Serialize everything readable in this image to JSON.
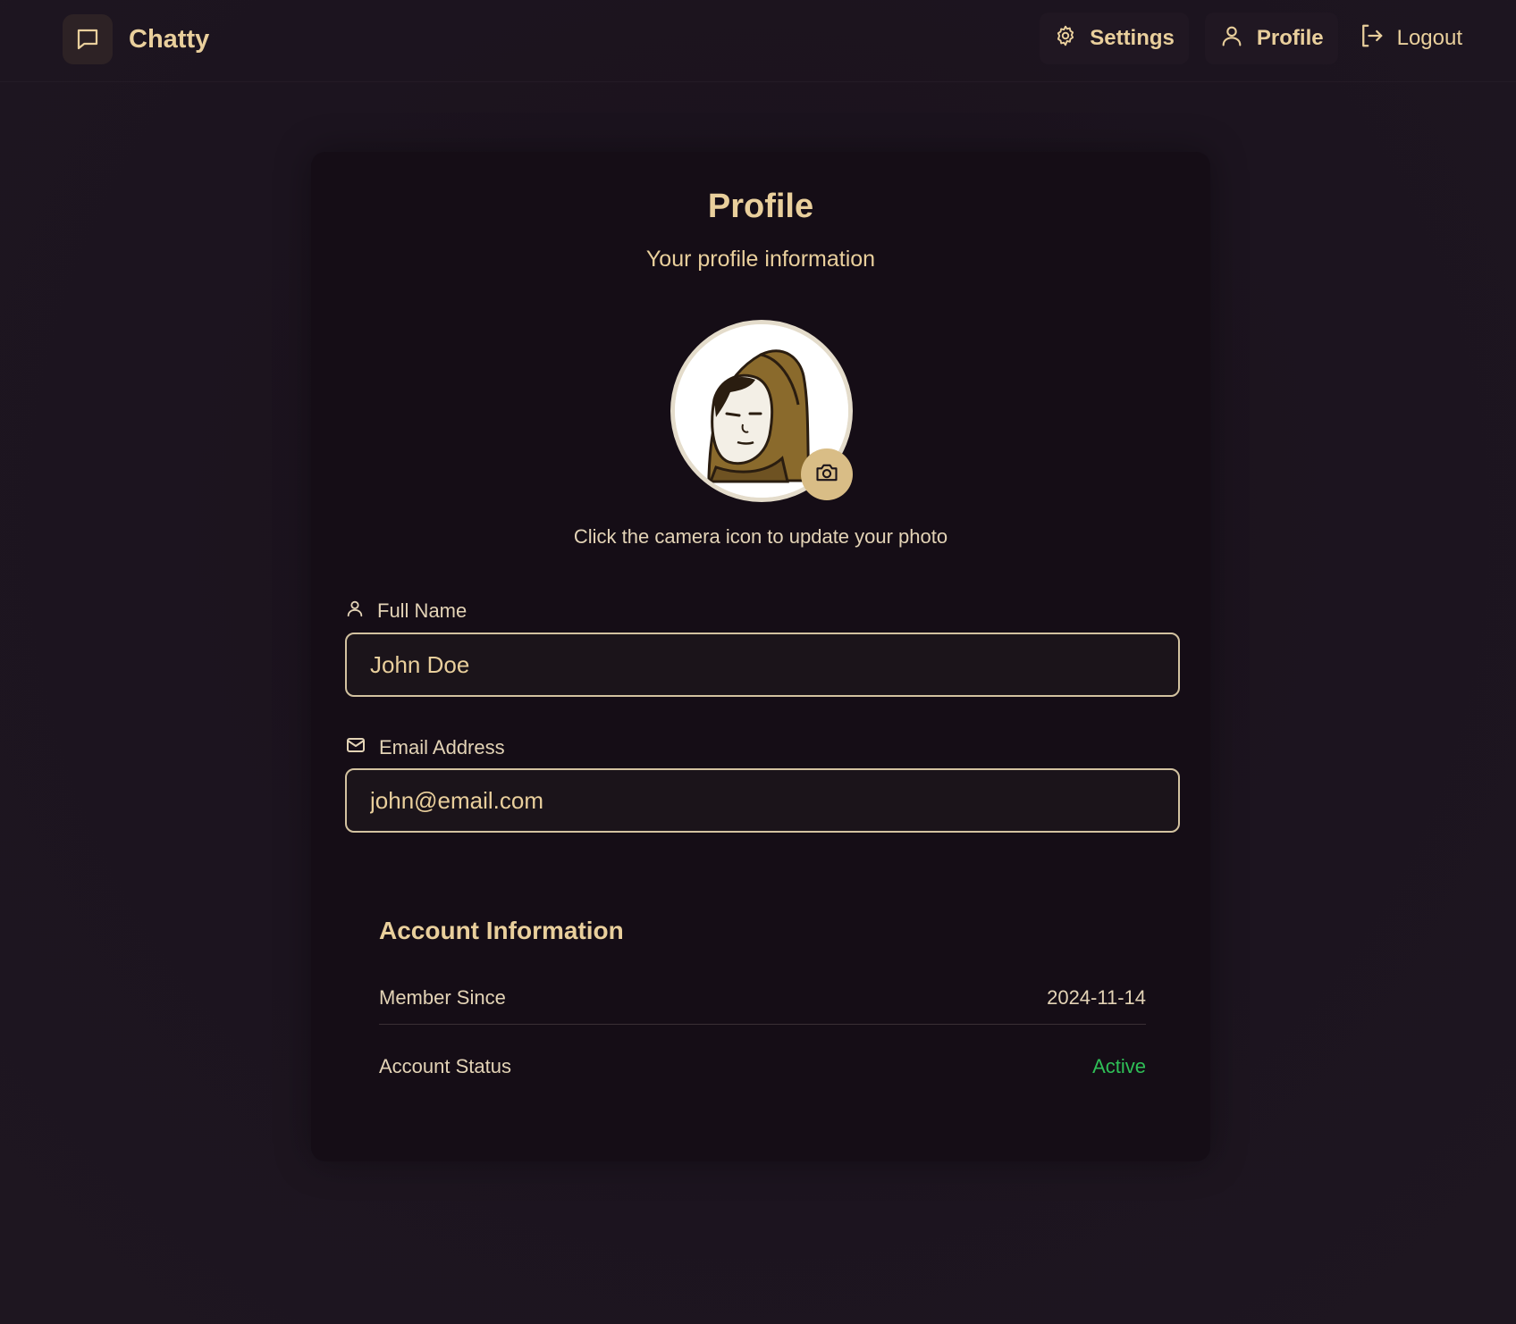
{
  "app": {
    "name": "Chatty",
    "logo_icon": "message-square-icon"
  },
  "nav": {
    "settings_label": "Settings",
    "profile_label": "Profile",
    "logout_label": "Logout"
  },
  "profile": {
    "title": "Profile",
    "subtitle": "Your profile information",
    "avatar_hint": "Click the camera icon to update your photo",
    "camera_icon": "camera-icon",
    "full_name_label": "Full Name",
    "full_name_value": "John Doe",
    "email_label": "Email Address",
    "email_value": "john@email.com"
  },
  "account": {
    "title": "Account Information",
    "member_since_label": "Member Since",
    "member_since_value": "2024-11-14",
    "status_label": "Account Status",
    "status_value": "Active"
  },
  "colors": {
    "background": "#1c141f",
    "card": "#150d16",
    "accent": "#e9cf9c",
    "camera_button": "#d9bd86",
    "active_status": "#2fbf57"
  }
}
